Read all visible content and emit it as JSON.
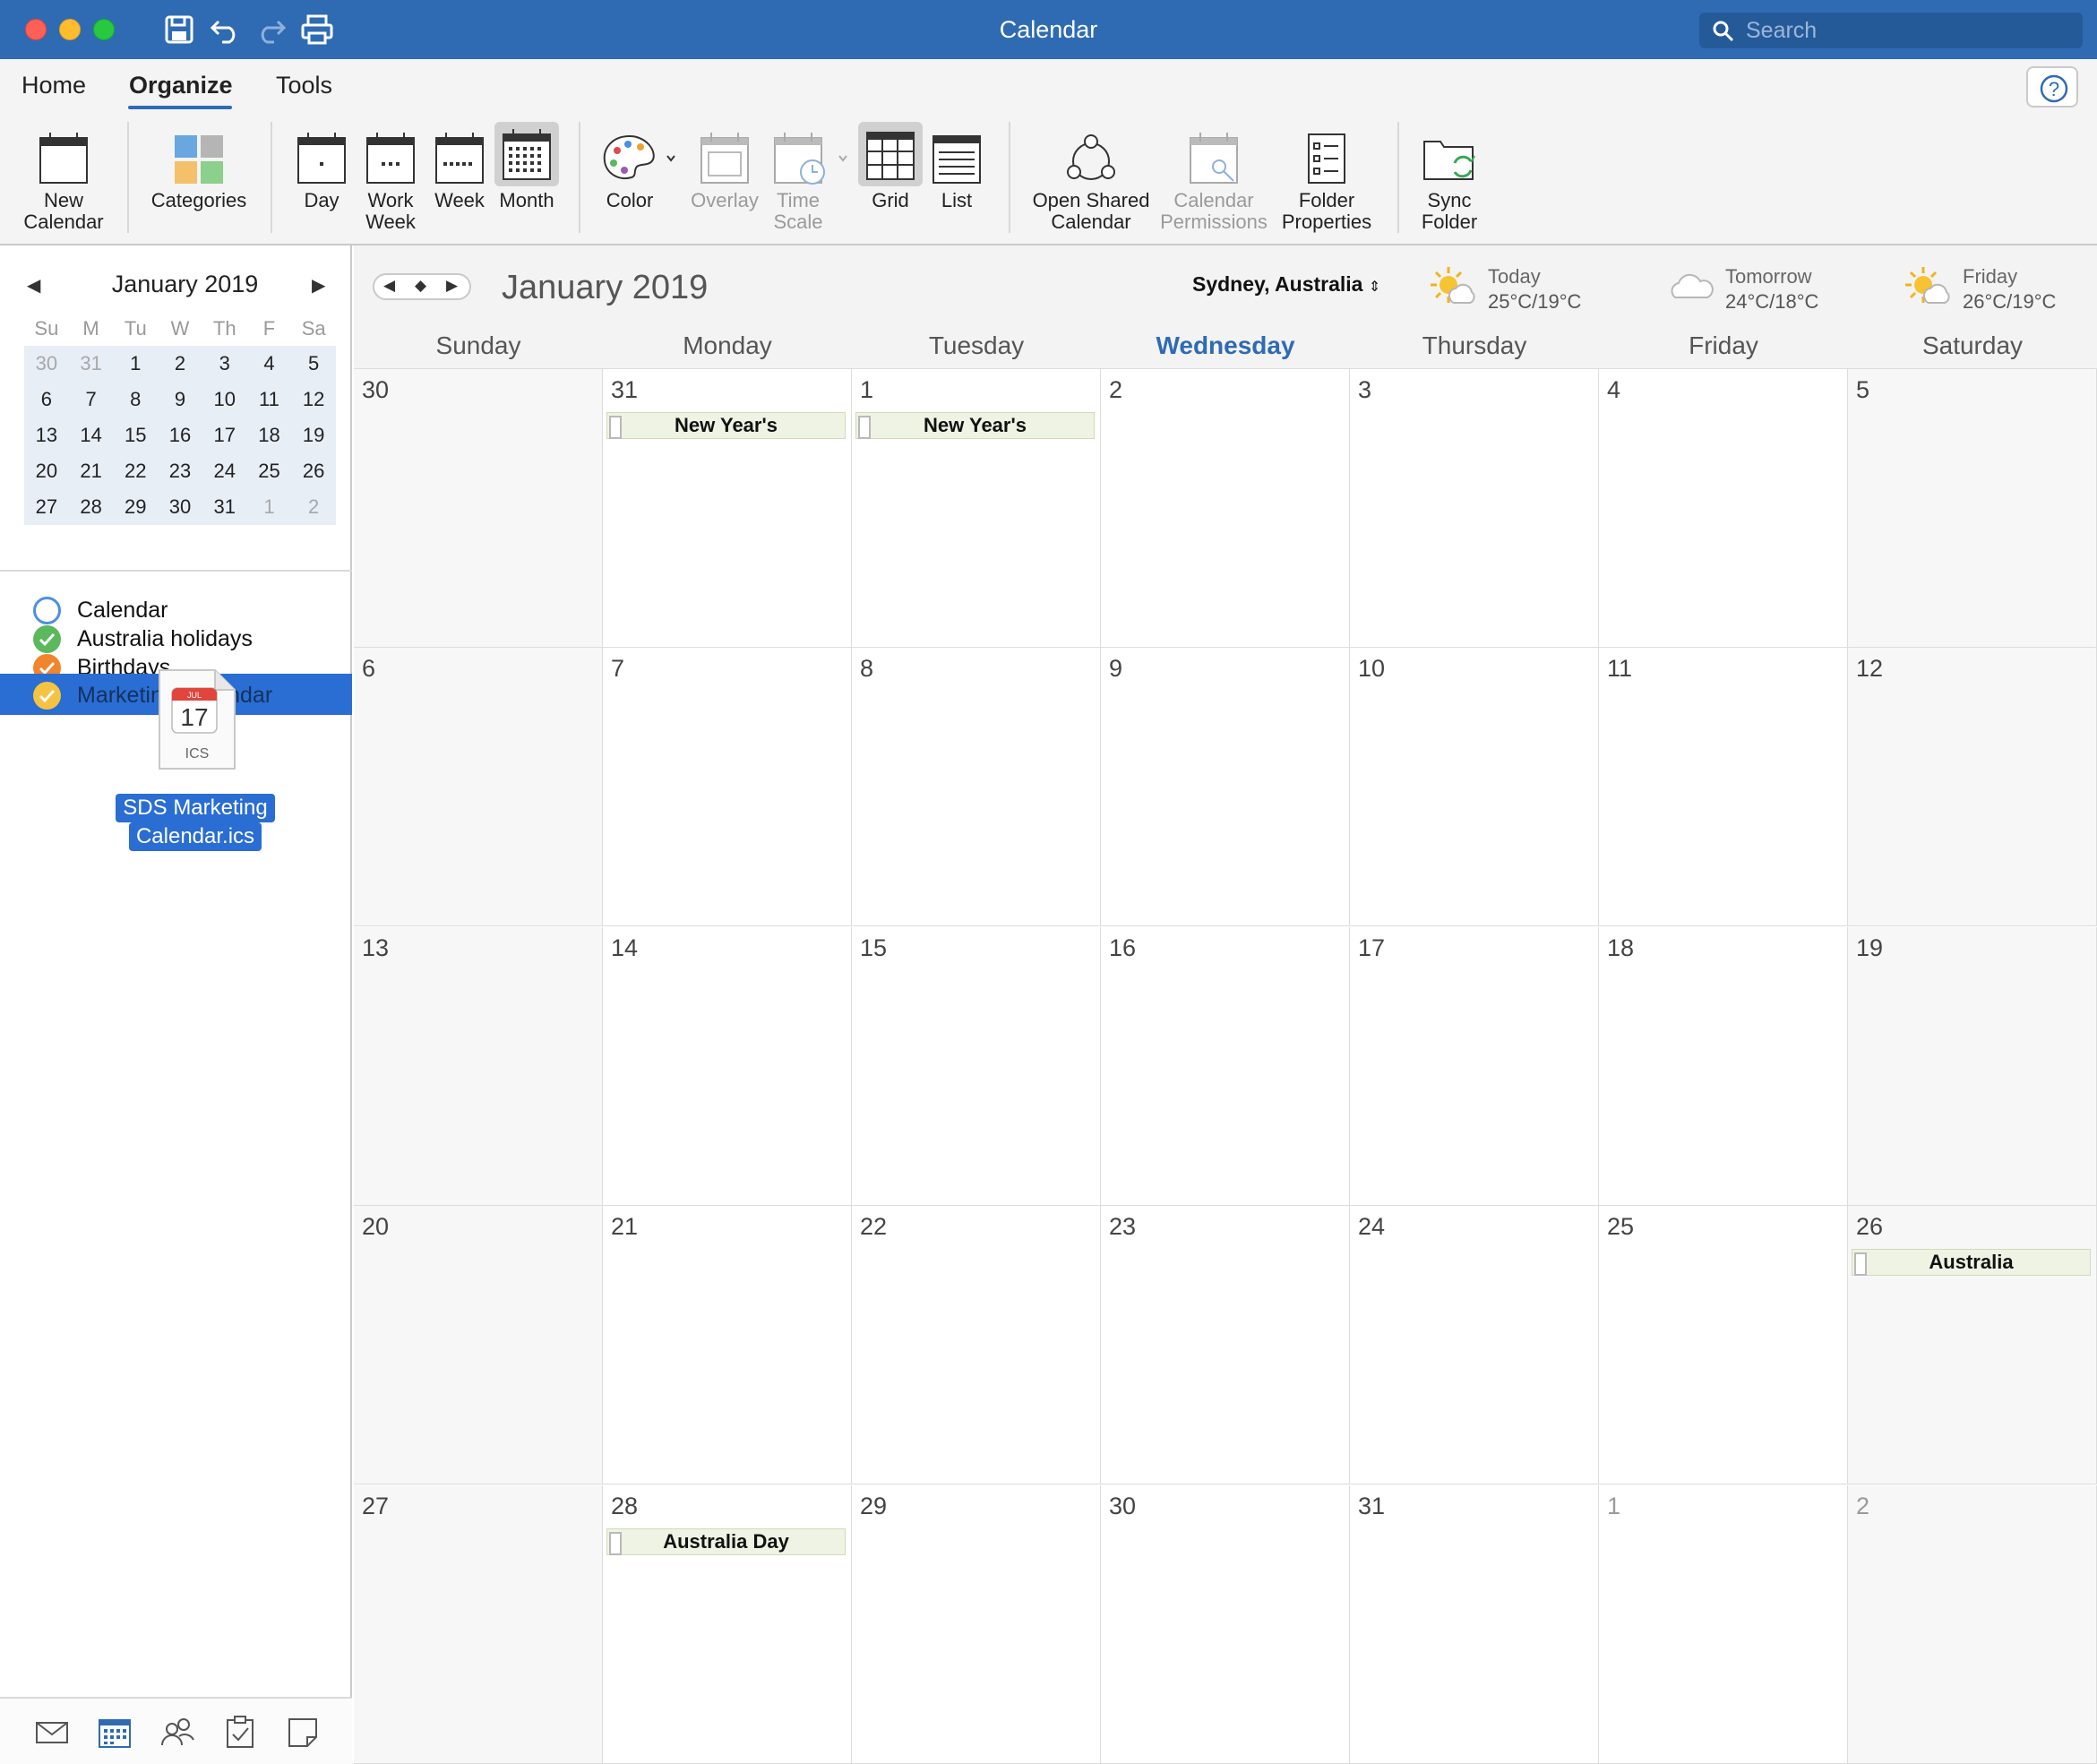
{
  "window": {
    "title": "Calendar"
  },
  "search": {
    "placeholder": "Search"
  },
  "ribbon": {
    "tabs": [
      {
        "label": "Home"
      },
      {
        "label": "Organize"
      },
      {
        "label": "Tools"
      }
    ],
    "active_tab": "Organize",
    "buttons": {
      "new_calendar": "New\nCalendar",
      "categories": "Categories",
      "day": "Day",
      "work_week": "Work\nWeek",
      "week": "Week",
      "month": "Month",
      "color": "Color",
      "overlay": "Overlay",
      "time_scale": "Time\nScale",
      "grid": "Grid",
      "list": "List",
      "open_shared": "Open Shared\nCalendar",
      "permissions": "Calendar\nPermissions",
      "folder_properties": "Folder\nProperties",
      "sync_folder": "Sync\nFolder"
    },
    "icons": {
      "new_calendar": "new-calendar-icon",
      "categories": "categories-icon",
      "day": "day-view-icon",
      "work_week": "work-week-view-icon",
      "week": "week-view-icon",
      "month": "month-view-icon",
      "color": "palette-icon",
      "overlay": "overlay-icon",
      "time_scale": "time-scale-icon",
      "grid": "grid-view-icon",
      "list": "list-view-icon",
      "open_shared": "shared-calendar-icon",
      "permissions": "calendar-permissions-icon",
      "folder_properties": "folder-properties-icon",
      "sync_folder": "sync-folder-icon"
    }
  },
  "mini_calendar": {
    "title": "January 2019",
    "dow": [
      "Su",
      "M",
      "Tu",
      "W",
      "Th",
      "F",
      "Sa"
    ],
    "weeks": [
      [
        "30",
        "31",
        "1",
        "2",
        "3",
        "4",
        "5"
      ],
      [
        "6",
        "7",
        "8",
        "9",
        "10",
        "11",
        "12"
      ],
      [
        "13",
        "14",
        "15",
        "16",
        "17",
        "18",
        "19"
      ],
      [
        "20",
        "21",
        "22",
        "23",
        "24",
        "25",
        "26"
      ],
      [
        "27",
        "28",
        "29",
        "30",
        "31",
        "1",
        "2"
      ]
    ]
  },
  "calendars": [
    {
      "name": "Calendar",
      "state": "unchecked",
      "color": "#4a90e2"
    },
    {
      "name": "Australia holidays",
      "state": "checked",
      "color": "#5cb85c"
    },
    {
      "name": "Birthdays",
      "state": "checked",
      "color": "#f0852d"
    },
    {
      "name": "Marketing Calendar",
      "state": "checked",
      "color": "#f5c342",
      "selected": true
    }
  ],
  "drag_file": {
    "badge_month": "JUL",
    "badge_day": "17",
    "ext": "ICS",
    "name_line1": "SDS Marketing",
    "name_line2": "Calendar.ics"
  },
  "main": {
    "title": "January 2019",
    "location": "Sydney, Australia",
    "weather": [
      {
        "day": "Today",
        "temp": "25°C/19°C",
        "icon": "sun-cloud-icon"
      },
      {
        "day": "Tomorrow",
        "temp": "24°C/18°C",
        "icon": "cloud-icon"
      },
      {
        "day": "Friday",
        "temp": "26°C/19°C",
        "icon": "sun-cloud-icon"
      }
    ],
    "dow": [
      "Sunday",
      "Monday",
      "Tuesday",
      "Wednesday",
      "Thursday",
      "Friday",
      "Saturday"
    ],
    "today_dow": "Wednesday",
    "weeks": [
      [
        {
          "d": "30"
        },
        {
          "d": "31",
          "ev": "New Year's"
        },
        {
          "d": "1",
          "ev": "New Year's"
        },
        {
          "d": "2"
        },
        {
          "d": "3"
        },
        {
          "d": "4"
        },
        {
          "d": "5"
        }
      ],
      [
        {
          "d": "6"
        },
        {
          "d": "7"
        },
        {
          "d": "8"
        },
        {
          "d": "9"
        },
        {
          "d": "10"
        },
        {
          "d": "11"
        },
        {
          "d": "12"
        }
      ],
      [
        {
          "d": "13"
        },
        {
          "d": "14"
        },
        {
          "d": "15"
        },
        {
          "d": "16"
        },
        {
          "d": "17"
        },
        {
          "d": "18"
        },
        {
          "d": "19"
        }
      ],
      [
        {
          "d": "20"
        },
        {
          "d": "21"
        },
        {
          "d": "22"
        },
        {
          "d": "23"
        },
        {
          "d": "24"
        },
        {
          "d": "25"
        },
        {
          "d": "26",
          "ev": "Australia"
        }
      ],
      [
        {
          "d": "27"
        },
        {
          "d": "28",
          "ev": "Australia Day"
        },
        {
          "d": "29"
        },
        {
          "d": "30"
        },
        {
          "d": "31"
        },
        {
          "d": "1",
          "dim": true
        },
        {
          "d": "2",
          "dim": true
        }
      ]
    ]
  },
  "bottom_nav": [
    "mail-icon",
    "calendar-icon",
    "people-icon",
    "tasks-icon",
    "notes-icon"
  ]
}
